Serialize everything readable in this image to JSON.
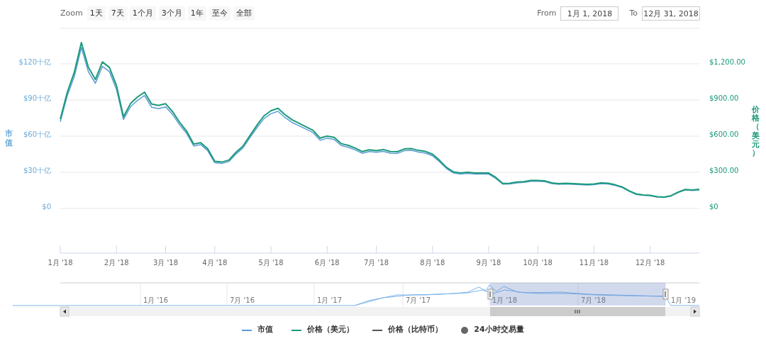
{
  "range_selector": {
    "label": "Zoom",
    "buttons": [
      {
        "label": "1天",
        "selected": false
      },
      {
        "label": "7天",
        "selected": false
      },
      {
        "label": "1个月",
        "selected": false
      },
      {
        "label": "3个月",
        "selected": false
      },
      {
        "label": "1年",
        "selected": false
      },
      {
        "label": "至今",
        "selected": false
      },
      {
        "label": "全部",
        "selected": false
      }
    ]
  },
  "date_range": {
    "from_label": "From",
    "from_value": "1月 1, 2018",
    "to_label": "To",
    "to_value": "12月 31, 2018"
  },
  "chart": {
    "left_axis": {
      "title": "市值",
      "ticks": [
        "$120十亿",
        "$90十亿",
        "$60十亿",
        "$30十亿",
        "$0"
      ]
    },
    "right_axis": {
      "title": "价格（美元）"
    },
    "chart_data": {
      "type": "line",
      "grid": true,
      "ylim": [
        -370,
        1494
      ],
      "categories": [
        "1月 '18",
        null,
        null,
        null,
        null,
        null,
        null,
        null,
        "2月 '18",
        null,
        null,
        null,
        null,
        null,
        null,
        "3月 '18",
        null,
        null,
        null,
        null,
        null,
        null,
        "4月 '18",
        null,
        null,
        null,
        null,
        null,
        null,
        null,
        "5月 '18",
        null,
        null,
        null,
        null,
        null,
        null,
        null,
        "6月 '18",
        null,
        null,
        null,
        null,
        null,
        null,
        "7月 '18",
        null,
        null,
        null,
        null,
        null,
        null,
        null,
        "8月 '18",
        null,
        null,
        null,
        null,
        null,
        null,
        null,
        "9月 '18",
        null,
        null,
        null,
        null,
        null,
        null,
        "10月 '18",
        null,
        null,
        null,
        null,
        null,
        null,
        null,
        "11月 '18",
        null,
        null,
        null,
        null,
        null,
        null,
        null,
        "12月 '18",
        null,
        null,
        null,
        null,
        null,
        null,
        null
      ],
      "yticks": [
        {
          "value": 0,
          "label": "$0"
        },
        {
          "value": 300,
          "label": "$300.00"
        },
        {
          "value": 600,
          "label": "$600.00"
        },
        {
          "value": 900,
          "label": "$900.00"
        },
        {
          "value": 1200,
          "label": "$1,200.00"
        }
      ],
      "series": [
        {
          "name": "市值",
          "color": "#5b9bd5",
          "values": [
            719,
            936,
            1096,
            1335,
            1135,
            1038,
            1179,
            1135,
            989,
            737,
            844,
            897,
            936,
            840,
            828,
            843,
            779,
            694,
            622,
            518,
            530,
            479,
            379,
            373,
            389,
            451,
            501,
            586,
            669,
            745,
            786,
            806,
            755,
            714,
            686,
            658,
            629,
            566,
            582,
            572,
            522,
            508,
            486,
            458,
            472,
            466,
            474,
            458,
            457,
            479,
            482,
            468,
            459,
            437,
            388,
            331,
            294,
            285,
            291,
            285,
            285,
            285,
            250,
            202,
            203,
            213,
            216,
            225,
            225,
            222,
            206,
            200,
            203,
            200,
            198,
            194,
            197,
            206,
            203,
            191,
            174,
            142,
            117,
            109,
            106,
            95,
            92,
            104,
            132,
            153,
            149,
            154
          ]
        },
        {
          "name": "价格（美元）",
          "color": "#1a9a7a",
          "values": [
            741,
            965,
            1130,
            1376,
            1170,
            1070,
            1215,
            1170,
            1020,
            760,
            870,
            925,
            965,
            866,
            854,
            869,
            803,
            715,
            641,
            534,
            546,
            494,
            391,
            385,
            401,
            465,
            516,
            604,
            690,
            768,
            810,
            831,
            778,
            736,
            707,
            678,
            648,
            584,
            600,
            590,
            538,
            524,
            501,
            472,
            487,
            480,
            489,
            472,
            471,
            494,
            497,
            482,
            473,
            450,
            400,
            341,
            303,
            294,
            300,
            294,
            294,
            294,
            258,
            208,
            209,
            220,
            223,
            232,
            232,
            229,
            212,
            206,
            209,
            206,
            204,
            200,
            203,
            212,
            209,
            197,
            179,
            146,
            121,
            112,
            109,
            98,
            95,
            107,
            136,
            158,
            154,
            159
          ]
        }
      ]
    }
  },
  "navigator": {
    "labels": [
      "1月 '16",
      "7月 '16",
      "1月 '17",
      "7月 '17",
      "1月 '18",
      "7月 '18",
      "1月 '19"
    ]
  },
  "legend_extra": [
    {
      "label": "价格（比特币）",
      "color": "#555555",
      "kind": "line"
    },
    {
      "label": "24小时交易量",
      "color": "#666666",
      "kind": "dot"
    }
  ]
}
